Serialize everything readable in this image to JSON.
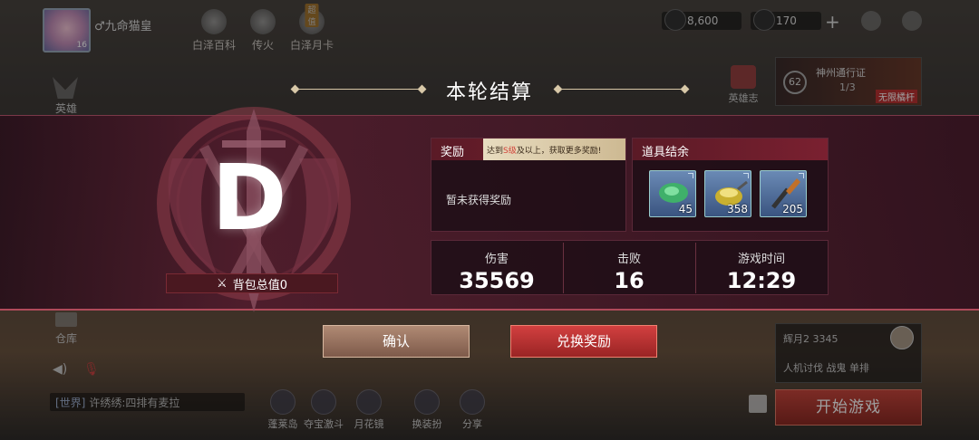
{
  "player": {
    "name": "九命猫皇",
    "level": "16"
  },
  "topnav": [
    {
      "label": "白泽百科",
      "badge": ""
    },
    {
      "label": "传火",
      "badge": ""
    },
    {
      "label": "白泽月卡",
      "badge": "超值"
    }
  ],
  "currency": {
    "gold": "8,600",
    "gem": "170"
  },
  "side": {
    "hero": "英雄",
    "warehouse": "仓库",
    "hero_log": "英雄志"
  },
  "pass": {
    "level": "62",
    "title": "神州通行证",
    "progress": "1/3",
    "tag": "无限橘杆"
  },
  "chat": {
    "channel": "[世界]",
    "message": "许绣绣:四排有麦拉"
  },
  "bottom_nav": [
    "蓬莱岛",
    "夺宝激斗",
    "月花镜",
    "换装扮",
    "分享"
  ],
  "room": {
    "name": "辉月2 3345",
    "mode": "人机讨伐 战鬼",
    "type": "单排"
  },
  "start_button": "开始游戏",
  "settlement": {
    "title": "本轮结算",
    "grade": "D",
    "bag_value_label": "背包总值0",
    "reward_header": "奖励",
    "reward_tip_pre": "达到",
    "reward_tip_hl": "S级",
    "reward_tip_post": "及以上，获取更多奖励!",
    "no_reward": "暂未获得奖励",
    "items_header": "道具结余",
    "items": [
      {
        "icon": "jade-icon",
        "count": "45"
      },
      {
        "icon": "lamp-icon",
        "count": "358"
      },
      {
        "icon": "torch-icon",
        "count": "205"
      }
    ],
    "stats": [
      {
        "label": "伤害",
        "value": "35569"
      },
      {
        "label": "击败",
        "value": "16"
      },
      {
        "label": "游戏时间",
        "value": "12:29"
      }
    ],
    "confirm": "确认",
    "exchange": "兑换奖励"
  }
}
